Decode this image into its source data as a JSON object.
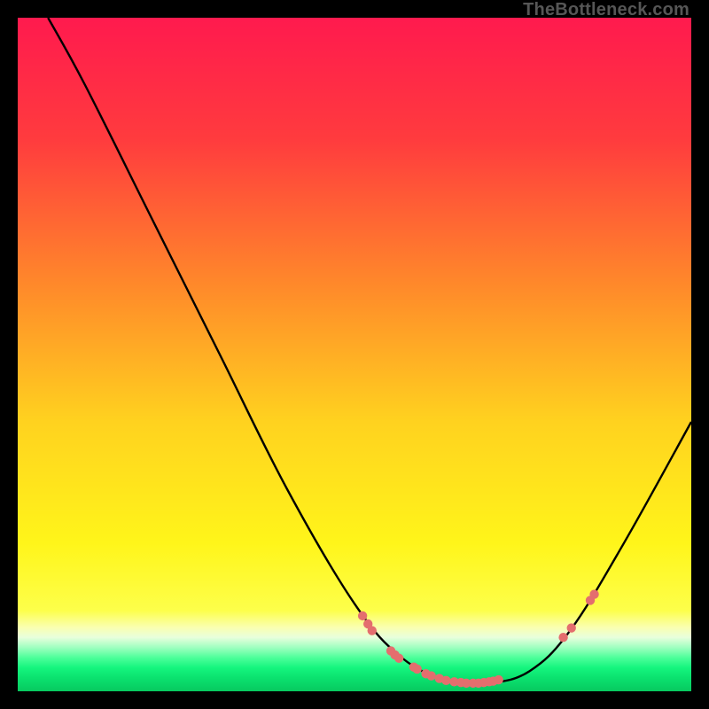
{
  "watermark": "TheBottleneck.com",
  "chart_data": {
    "type": "line",
    "title": "",
    "xlabel": "",
    "ylabel": "",
    "xlim": [
      0,
      100
    ],
    "ylim": [
      0,
      100
    ],
    "curve": [
      {
        "x": 4.5,
        "y": 100
      },
      {
        "x": 10,
        "y": 90
      },
      {
        "x": 20,
        "y": 70
      },
      {
        "x": 30,
        "y": 50
      },
      {
        "x": 40,
        "y": 30
      },
      {
        "x": 50,
        "y": 13
      },
      {
        "x": 57,
        "y": 5
      },
      {
        "x": 64,
        "y": 1.5
      },
      {
        "x": 70,
        "y": 1.2
      },
      {
        "x": 76,
        "y": 3
      },
      {
        "x": 82,
        "y": 9
      },
      {
        "x": 90,
        "y": 22
      },
      {
        "x": 100,
        "y": 40
      }
    ],
    "points": [
      {
        "x": 51.2,
        "y": 11.2
      },
      {
        "x": 52.0,
        "y": 10.0
      },
      {
        "x": 52.6,
        "y": 9.0
      },
      {
        "x": 55.4,
        "y": 6.0
      },
      {
        "x": 56.0,
        "y": 5.4
      },
      {
        "x": 56.6,
        "y": 4.9
      },
      {
        "x": 58.8,
        "y": 3.6
      },
      {
        "x": 59.3,
        "y": 3.3
      },
      {
        "x": 60.6,
        "y": 2.6
      },
      {
        "x": 61.4,
        "y": 2.3
      },
      {
        "x": 62.6,
        "y": 1.9
      },
      {
        "x": 63.6,
        "y": 1.6
      },
      {
        "x": 64.8,
        "y": 1.4
      },
      {
        "x": 65.8,
        "y": 1.3
      },
      {
        "x": 66.6,
        "y": 1.2
      },
      {
        "x": 67.6,
        "y": 1.2
      },
      {
        "x": 68.4,
        "y": 1.2
      },
      {
        "x": 69.2,
        "y": 1.3
      },
      {
        "x": 70.0,
        "y": 1.4
      },
      {
        "x": 70.6,
        "y": 1.5
      },
      {
        "x": 71.4,
        "y": 1.7
      },
      {
        "x": 81.0,
        "y": 8.0
      },
      {
        "x": 82.2,
        "y": 9.4
      },
      {
        "x": 85.0,
        "y": 13.5
      },
      {
        "x": 85.6,
        "y": 14.4
      }
    ],
    "gradient_stops": [
      {
        "offset": 0.0,
        "color": "#ff1a4e"
      },
      {
        "offset": 0.18,
        "color": "#ff3b3e"
      },
      {
        "offset": 0.4,
        "color": "#ff8a2a"
      },
      {
        "offset": 0.6,
        "color": "#ffd21f"
      },
      {
        "offset": 0.78,
        "color": "#fff51a"
      },
      {
        "offset": 0.88,
        "color": "#fdff4a"
      },
      {
        "offset": 0.905,
        "color": "#faffb0"
      },
      {
        "offset": 0.92,
        "color": "#e8ffdc"
      },
      {
        "offset": 0.935,
        "color": "#9fffc0"
      },
      {
        "offset": 0.95,
        "color": "#4dff9a"
      },
      {
        "offset": 0.965,
        "color": "#15f57e"
      },
      {
        "offset": 0.98,
        "color": "#0be26f"
      },
      {
        "offset": 1.0,
        "color": "#07c95f"
      }
    ],
    "point_color": "#e46e6e",
    "line_color": "#000000"
  }
}
